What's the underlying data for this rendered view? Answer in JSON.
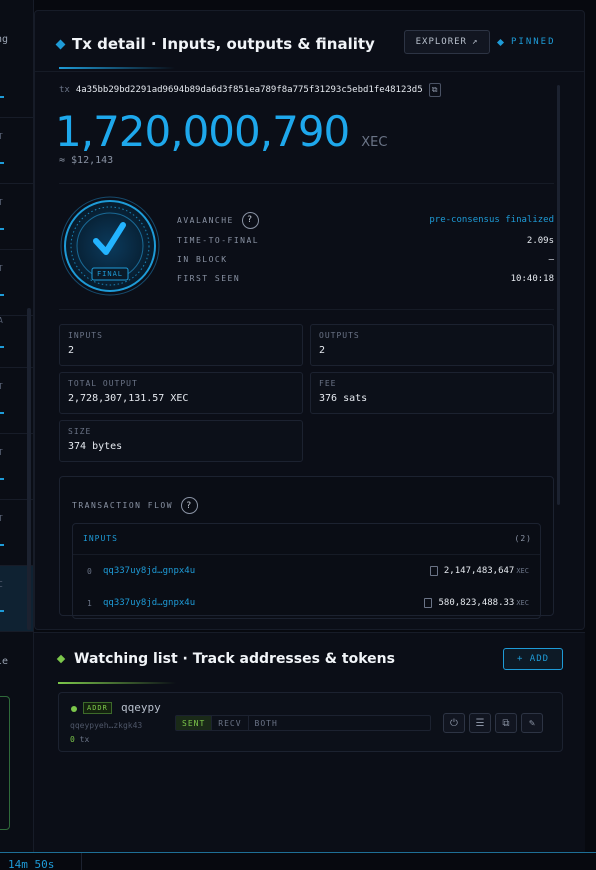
{
  "sidebar": {
    "top_label": "ng",
    "items": [
      {
        "glyph": ""
      },
      {
        "glyph": "T"
      },
      {
        "glyph": "T"
      },
      {
        "glyph": "T"
      },
      {
        "glyph": "A"
      },
      {
        "glyph": "T"
      },
      {
        "glyph": "T"
      },
      {
        "glyph": "T"
      },
      {
        "glyph": "C"
      }
    ],
    "bottom_label": "le"
  },
  "tx_panel": {
    "title": "Tx detail · Inputs, outputs & finality",
    "explorer_label": "EXPLORER",
    "explorer_icon": "↗",
    "pinned_label": "PINNED",
    "tx_label": "tx",
    "tx_hash": "4a35bb29bd2291ad9694b89da6d3f851ea789f8a775f31293c5ebd1fe48123d5",
    "amount": "1,720,000,790",
    "amount_unit": "XEC",
    "fiat": "≈ $12,143",
    "final_badge": "FINAL",
    "finality": {
      "avalanche_label": "AVALANCHE",
      "avalanche_value": "pre-consensus finalized",
      "ttf_label": "TIME-TO-FINAL",
      "ttf_value": "2.09s",
      "block_label": "IN BLOCK",
      "block_value": "—",
      "seen_label": "FIRST SEEN",
      "seen_value": "10:40:18"
    },
    "stats": {
      "inputs_label": "INPUTS",
      "inputs_value": "2",
      "outputs_label": "OUTPUTS",
      "outputs_value": "2",
      "total_label": "TOTAL OUTPUT",
      "total_value": "2,728,307,131.57 XEC",
      "fee_label": "FEE",
      "fee_value": "376 sats",
      "size_label": "SIZE",
      "size_value": "374 bytes"
    },
    "flow": {
      "title": "TRANSACTION FLOW",
      "inputs_header": "INPUTS",
      "inputs_count": "(2)",
      "inputs": [
        {
          "idx": "0",
          "addr": "qq337uy8jd…gnpx4u",
          "amount": "2,147,483,647",
          "unit": "XEC"
        },
        {
          "idx": "1",
          "addr": "qq337uy8jd…gnpx4u",
          "amount": "580,823,488.33",
          "unit": "XEC"
        }
      ]
    }
  },
  "watch_panel": {
    "title": "Watching list · Track addresses & tokens",
    "add_label": "+ ADD",
    "item": {
      "badge": "ADDR",
      "name": "qqeypy",
      "address": "qqeypyeh…zkgk43",
      "tx_count": "0",
      "tx_unit": "tx",
      "modes": [
        "SENT",
        "RECV",
        "BOTH"
      ]
    }
  },
  "footer": {
    "timer": "14m 50s"
  },
  "colors": {
    "accent_blue": "#1e9bd7",
    "accent_green": "#7cc74b",
    "background": "#07090f"
  }
}
